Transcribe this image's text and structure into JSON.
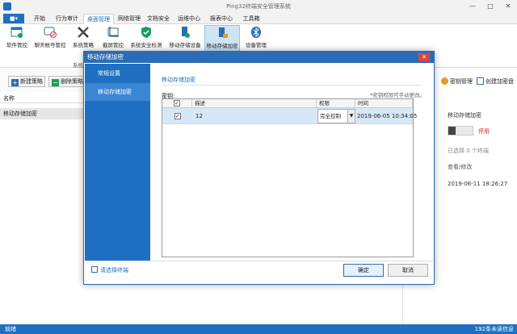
{
  "window": {
    "title": "Ping32终端安全管理系统",
    "min": "—",
    "max": "□",
    "close": "✕"
  },
  "menu": {
    "file": "■▾",
    "items": [
      "开始",
      "行为审计",
      "桌面管理",
      "网络管理",
      "文档安全",
      "运维中心",
      "报表中心",
      "工具箱"
    ],
    "active_index": 2
  },
  "ribbon": {
    "buttons": [
      "软件管控",
      "聊天帐号管控",
      "系统策略",
      "截屏管控",
      "系统安全检测",
      "移动存储设备",
      "移动存储加密",
      "设备管理"
    ],
    "selected_index": 6,
    "group_label": "系统"
  },
  "left_panel": {
    "new_policy": "新建策略",
    "delete_policy": "删除策略",
    "column_name": "名称",
    "rows": [
      "移动存储加密"
    ]
  },
  "right_panel": {
    "key_manage": "密钥管理",
    "create_key": "创建加密盘",
    "name": "移动存储加密",
    "toggle_label": "停用",
    "selected_count": "已选择 0 个终端",
    "view_edit": "查看/修改",
    "date": "2019-06-11 18:26:27"
  },
  "status": {
    "left": "就绪",
    "right": "192条未读信息"
  },
  "dialog": {
    "title": "移动存储加密",
    "close": "✕",
    "nav": [
      "常规设置",
      "移动存储加密"
    ],
    "nav_selected": 1,
    "section_title": "移动存储加密",
    "key_label": "密钥:",
    "hint": "*密钥权限可手动更改。",
    "grid": {
      "headers": [
        "描述",
        "权限",
        "时间"
      ],
      "rows": [
        {
          "checked": true,
          "desc": "12",
          "perm": "完全控制",
          "time": "2019-06-05 10:34:05"
        }
      ]
    },
    "footer_link": "请选择终端",
    "ok": "确定",
    "cancel": "取消"
  },
  "colors": {
    "accent": "#1e6fc2",
    "dialog_title": "#2b6db5",
    "selected_row": "#d6e8f7",
    "danger": "#e04343"
  }
}
